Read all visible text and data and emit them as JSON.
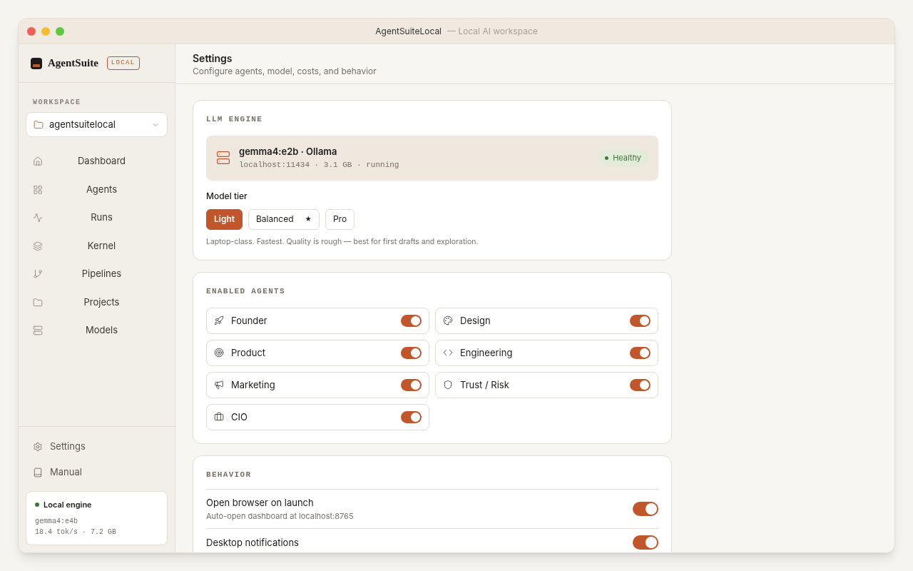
{
  "window": {
    "title": "AgentSuiteLocal",
    "subtitle": "— Local AI workspace"
  },
  "sidebar": {
    "brand": "AgentSuite",
    "badge": "LOCAL",
    "workspace_label": "WORKSPACE",
    "workspace": "agentsuitelocal",
    "items": [
      {
        "label": "Dashboard",
        "selected": false
      },
      {
        "label": "Agents",
        "selected": false
      },
      {
        "label": "Runs",
        "selected": false
      },
      {
        "label": "Kernel",
        "selected": false
      },
      {
        "label": "Pipelines",
        "selected": false
      },
      {
        "label": "Projects",
        "selected": false
      },
      {
        "label": "Models",
        "selected": false
      }
    ],
    "footer_items": [
      {
        "label": "Settings",
        "selected": false
      },
      {
        "label": "Manual",
        "selected": false
      }
    ],
    "engine": {
      "title": "Local engine",
      "model": "gemma4:e4b",
      "stats": "18.4 tok/s · 7.2 GB"
    }
  },
  "header": {
    "title": "Settings",
    "subtitle": "Configure agents, model, costs, and behavior"
  },
  "llm_engine": {
    "heading": "LLM ENGINE",
    "model": "gemma4:e2b · Ollama",
    "details": "localhost:11434 · 3.1 GB · running",
    "status": "Healthy",
    "tier_label": "Model tier",
    "tiers": [
      {
        "label": "Light",
        "selected": true
      },
      {
        "label": "Balanced",
        "badge": "★",
        "selected": false
      },
      {
        "label": "Pro",
        "selected": false
      }
    ],
    "tier_note": "Laptop-class. Fastest. Quality is rough — best for first drafts and exploration."
  },
  "agents": {
    "heading": "ENABLED AGENTS",
    "items": [
      {
        "label": "Founder",
        "on": true
      },
      {
        "label": "Design",
        "on": true
      },
      {
        "label": "Product",
        "on": true
      },
      {
        "label": "Engineering",
        "on": true
      },
      {
        "label": "Marketing",
        "on": true
      },
      {
        "label": "Trust / Risk",
        "on": true
      },
      {
        "label": "CIO",
        "on": true
      }
    ]
  },
  "behavior": {
    "heading": "BEHAVIOR",
    "items": [
      {
        "title": "Open browser on launch",
        "description": "Auto-open dashboard at localhost:8765",
        "on": true
      },
      {
        "title": "Desktop notifications",
        "on": true
      }
    ]
  }
}
